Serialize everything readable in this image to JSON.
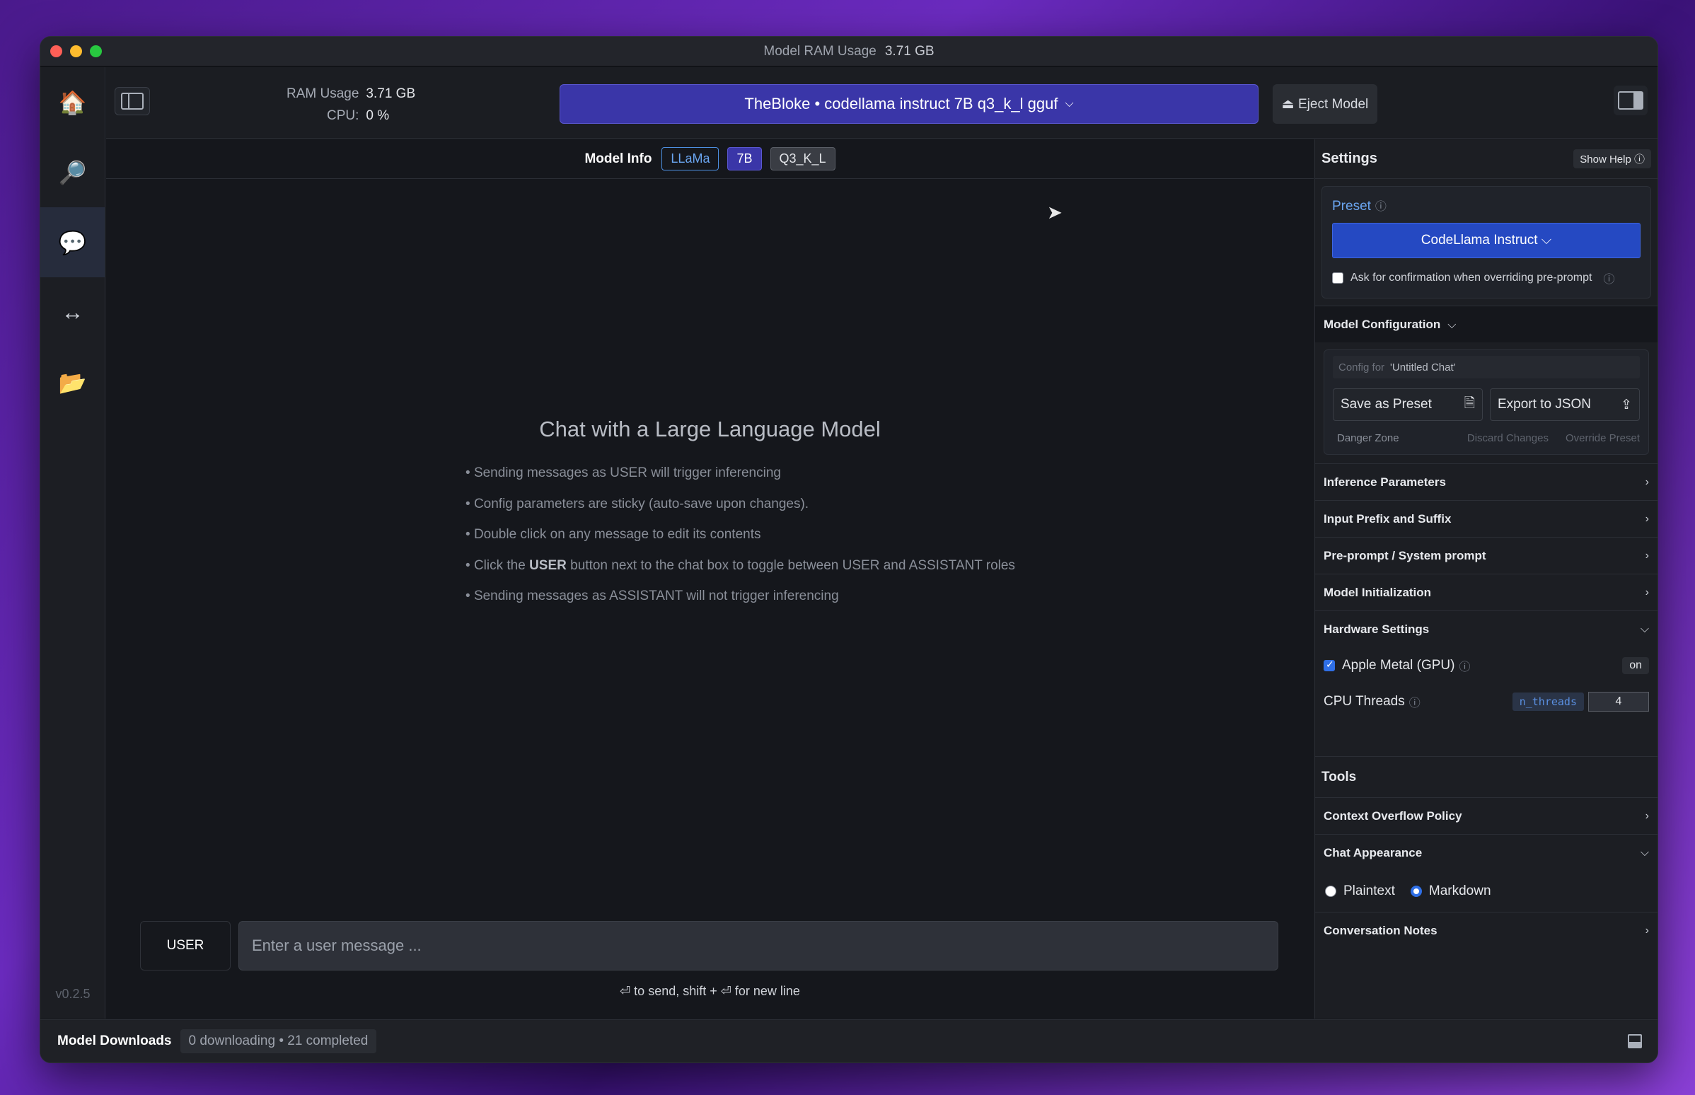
{
  "window": {
    "title_label": "Model RAM Usage",
    "title_value": "3.71 GB"
  },
  "sidebar": {
    "items": [
      {
        "icon": "home-icon",
        "glyph": "🏠"
      },
      {
        "icon": "search-icon",
        "glyph": "🔎"
      },
      {
        "icon": "chat-icon",
        "glyph": "💬"
      },
      {
        "icon": "server-arrows-icon",
        "glyph": "↔"
      },
      {
        "icon": "folder-icon",
        "glyph": "📂"
      }
    ],
    "version": "v0.2.5"
  },
  "topbar": {
    "ram_label": "RAM Usage",
    "ram_value": "3.71 GB",
    "cpu_label": "CPU:",
    "cpu_value": "0 %",
    "model_name": "TheBloke • codellama instruct 7B q3_k_l gguf",
    "model_chevron": "⌵",
    "eject_label": "⏏ Eject Model"
  },
  "model_info": {
    "label": "Model Info",
    "badges": [
      "LLaMa",
      "7B",
      "Q3_K_L"
    ]
  },
  "chat": {
    "heading": "Chat with a Large Language Model",
    "tips": [
      "Sending messages as USER will trigger inferencing",
      "Config parameters are sticky (auto-save upon changes).",
      "Double click on any message to edit its contents"
    ],
    "tip4_pre": "Click the ",
    "tip4_bold": "USER",
    "tip4_post": " button next to the chat box to toggle between USER and ASSISTANT roles",
    "tip5": "Sending messages as ASSISTANT will not trigger inferencing",
    "role_button": "USER",
    "input_placeholder": "Enter a user message ...",
    "send_hint": "⏎ to send, shift + ⏎ for new line"
  },
  "settings": {
    "title": "Settings",
    "show_help": "Show Help ⓘ",
    "preset_label": "Preset",
    "preset_value": "CodeLlama Instruct ⌵",
    "confirm_label": "Ask for confirmation when overriding pre-prompt",
    "model_config": "Model Configuration",
    "config_for_label": "Config for",
    "config_for_value": "'Untitled Chat'",
    "save_preset": "Save as Preset",
    "export_json": "Export to JSON",
    "danger_zone": "Danger Zone",
    "discard_changes": "Discard Changes",
    "override_preset": "Override Preset",
    "sections": {
      "inference": "Inference Parameters",
      "prefix_suffix": "Input Prefix and Suffix",
      "preprompt": "Pre-prompt / System prompt",
      "model_init": "Model Initialization",
      "hardware": "Hardware Settings"
    },
    "gpu_label": "Apple Metal (GPU)",
    "gpu_state": "on",
    "cpu_threads_label": "CPU Threads",
    "cpu_threads_param": "n_threads",
    "cpu_threads_value": "4",
    "tools_title": "Tools",
    "context_overflow": "Context Overflow Policy",
    "chat_appearance": "Chat Appearance",
    "plaintext": "Plaintext",
    "markdown": "Markdown",
    "conversation_notes": "Conversation Notes"
  },
  "bottombar": {
    "title": "Model Downloads",
    "status": "0 downloading • 21 completed"
  }
}
